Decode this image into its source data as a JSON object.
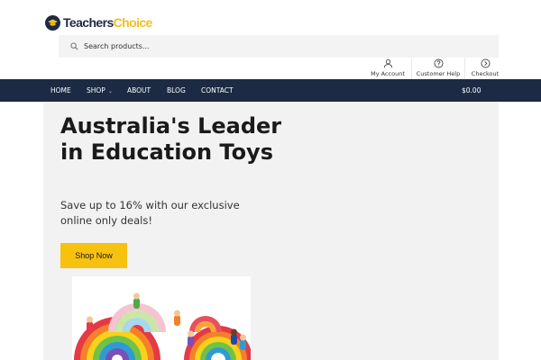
{
  "brand": {
    "name_part1": "Teachers",
    "name_part2": "Choice",
    "colors": {
      "navy": "#1c2a44",
      "yellow": "#f3bf1a"
    }
  },
  "search": {
    "placeholder": "Search products...",
    "icon": "search-icon"
  },
  "utility": {
    "account": {
      "label": "My Account",
      "icon": "user-icon"
    },
    "help": {
      "label": "Customer Help",
      "icon": "help-icon"
    },
    "checkout": {
      "label": "Checkout",
      "icon": "arrow-circle-icon"
    }
  },
  "nav": {
    "items": [
      {
        "label": "HOME"
      },
      {
        "label": "SHOP"
      },
      {
        "label": "ABOUT"
      },
      {
        "label": "BLOG"
      },
      {
        "label": "CONTACT"
      }
    ],
    "cart_total": "$0.00"
  },
  "hero": {
    "title": "Australia's Leader in Education Toys",
    "subtitle": "Save up to 16% with our exclusive online only deals!",
    "cta": "Shop Now",
    "image_subject": "rainbow stacking toys with peg dolls"
  }
}
